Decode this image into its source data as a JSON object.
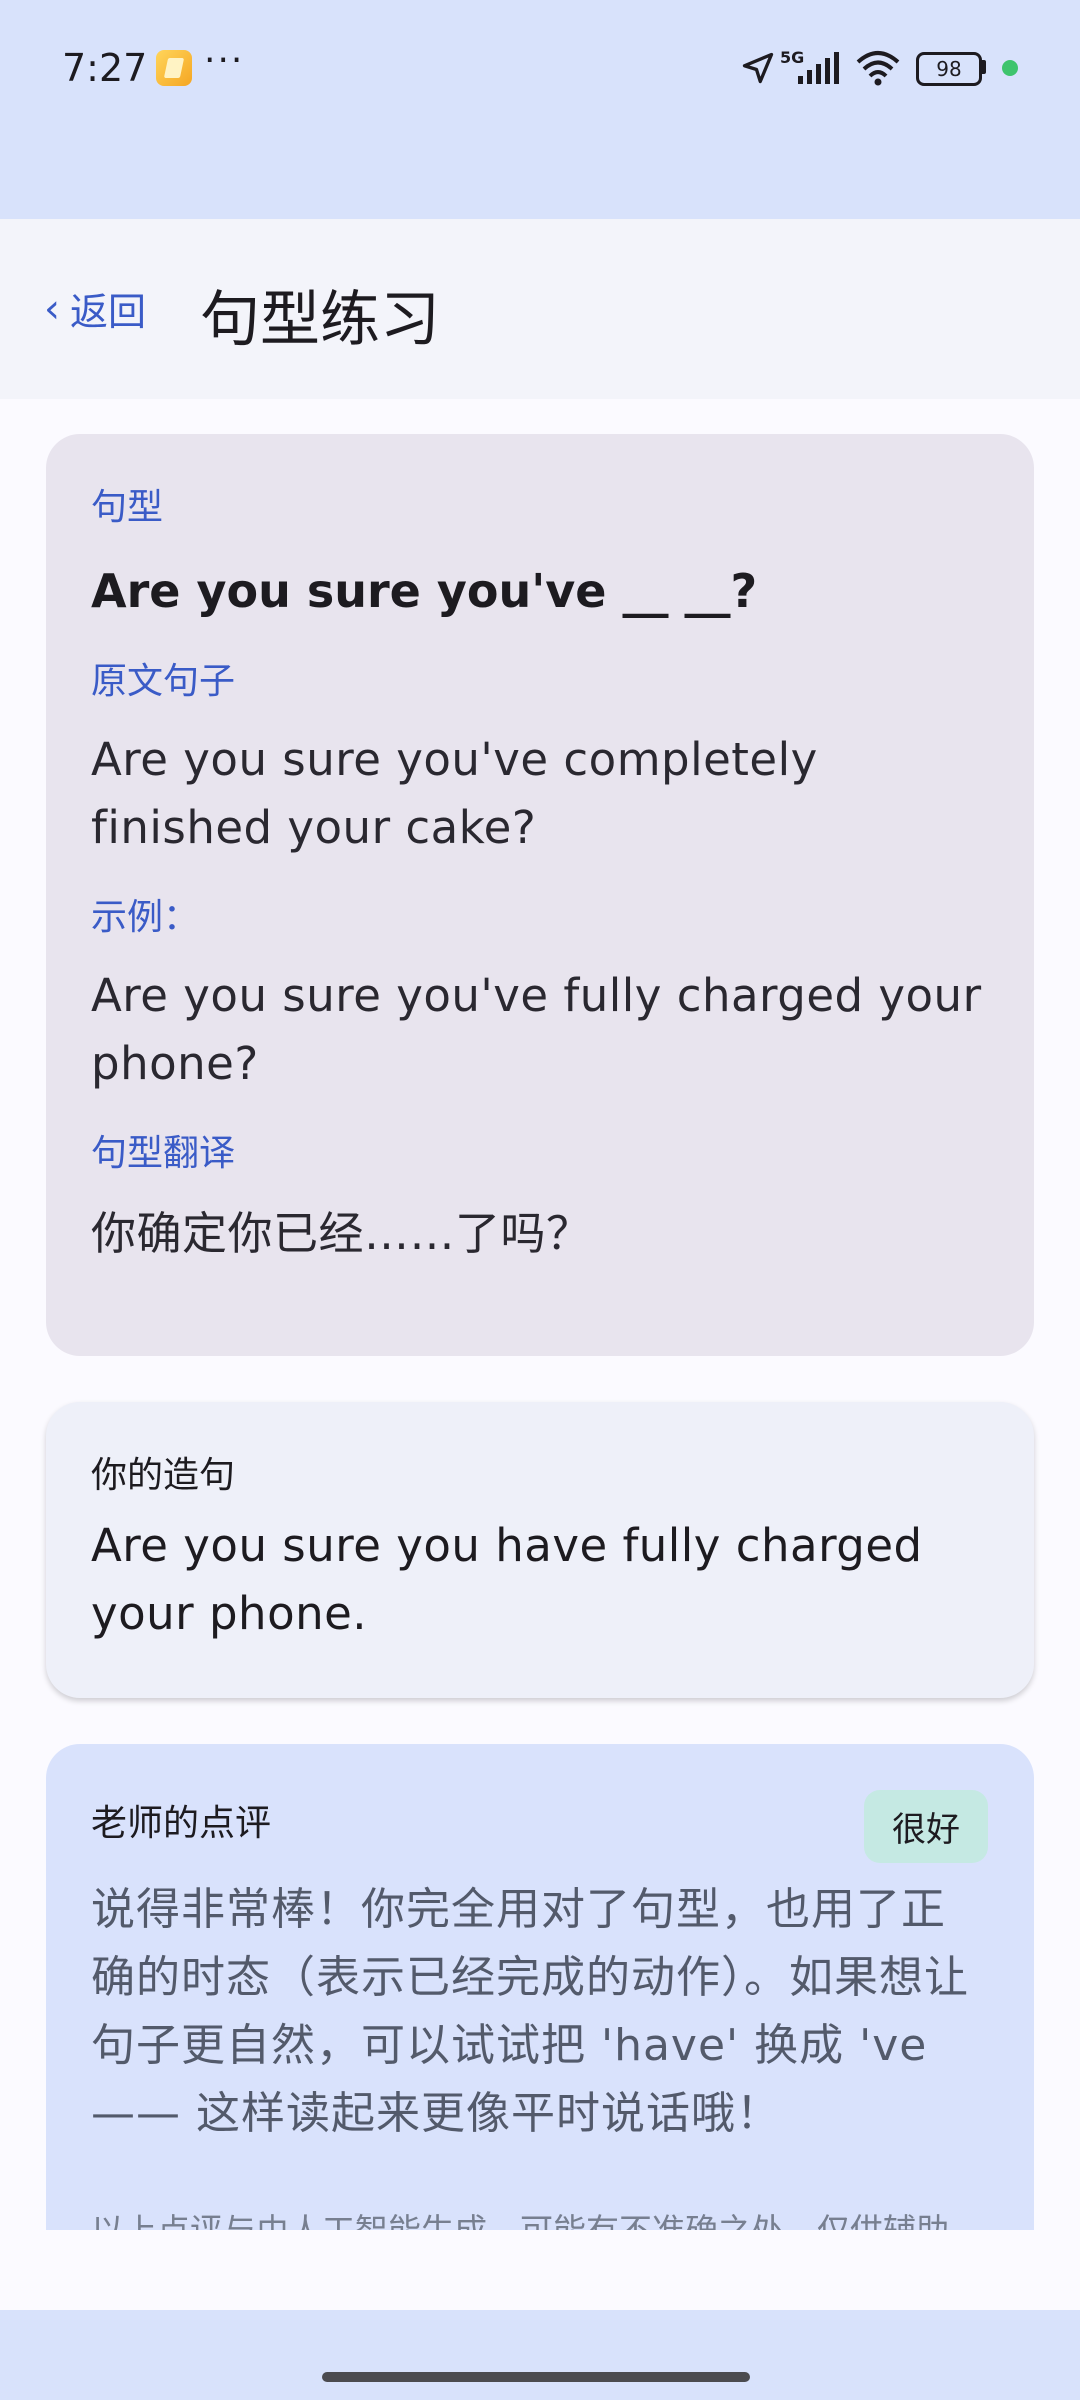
{
  "status_bar": {
    "time": "7:27",
    "network": "5G",
    "battery": "98"
  },
  "header": {
    "back_label": "返回",
    "title": "句型练习"
  },
  "pattern_card": {
    "pattern_label": "句型",
    "pattern": "Are you sure you've __ __?",
    "original_label": "原文句子",
    "original": "Are you sure you've completely finished your cake?",
    "example_label": "示例：",
    "example": "Are you sure you've fully charged your phone?",
    "translation_label": "句型翻译",
    "translation": "你确定你已经……了吗？"
  },
  "user_card": {
    "label": "你的造句",
    "sentence": "Are you sure you have fully charged your phone."
  },
  "review_card": {
    "label": "老师的点评",
    "badge": "很好",
    "text": "说得非常棒！你完全用对了句型，也用了正确的时态（表示已经完成的动作）。如果想让句子更自然，可以试试把 'have' 换成 've —— 这样读起来更像平时说话哦！",
    "disclaimer": "以上点评与由人工智能生成，可能有不准确之处，仅供辅助"
  },
  "colors": {
    "accent": "#3a5bc7",
    "status_bar_bg": "#d8e2fb",
    "pattern_card_bg": "#e8e4ee",
    "review_card_bg": "#d9e2fc",
    "badge_bg": "#c5e9e3"
  }
}
